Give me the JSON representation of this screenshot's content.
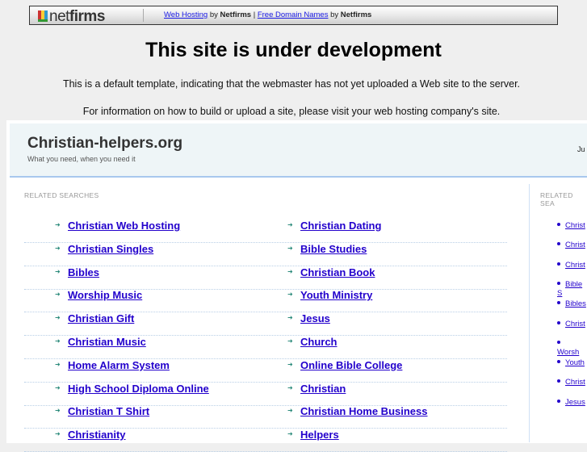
{
  "topbar": {
    "logo": "netfirms",
    "link1": "Web Hosting",
    "by1": " by ",
    "brand1": "Netfirms",
    "pipe": " | ",
    "link2": "Free Domain Names",
    "by2": " by ",
    "brand2": "Netfirms"
  },
  "title": "This site is under development",
  "line1": "This is a default template, indicating that the webmaster has not yet uploaded a Web site to the server.",
  "line2": "For information on how to build or upload a site, please visit your web hosting company's site.",
  "site": {
    "name": "Christian-helpers.org",
    "tagline": "What you need, when you need it",
    "right_text": "Ju"
  },
  "related_label": "RELATED SEARCHES",
  "side_label": "RELATED SEA",
  "left_col": [
    "Christian Web Hosting",
    "Christian Singles",
    "Bibles",
    "Worship Music",
    "Christian Gift",
    "Christian Music",
    "Home Alarm System",
    "High School Diploma Online",
    "Christian T Shirt",
    "Christianity"
  ],
  "right_col": [
    "Christian Dating",
    "Bible Studies",
    "Christian Book",
    "Youth Ministry",
    "Jesus",
    "Church",
    "Online Bible College",
    "Christian",
    "Christian Home Business",
    "Helpers"
  ],
  "side_items": [
    "Christ",
    "Christ",
    "Christ",
    "Bible S",
    "Bibles",
    "Christ",
    "Worsh",
    "Youth",
    "Christ",
    "Jesus"
  ]
}
